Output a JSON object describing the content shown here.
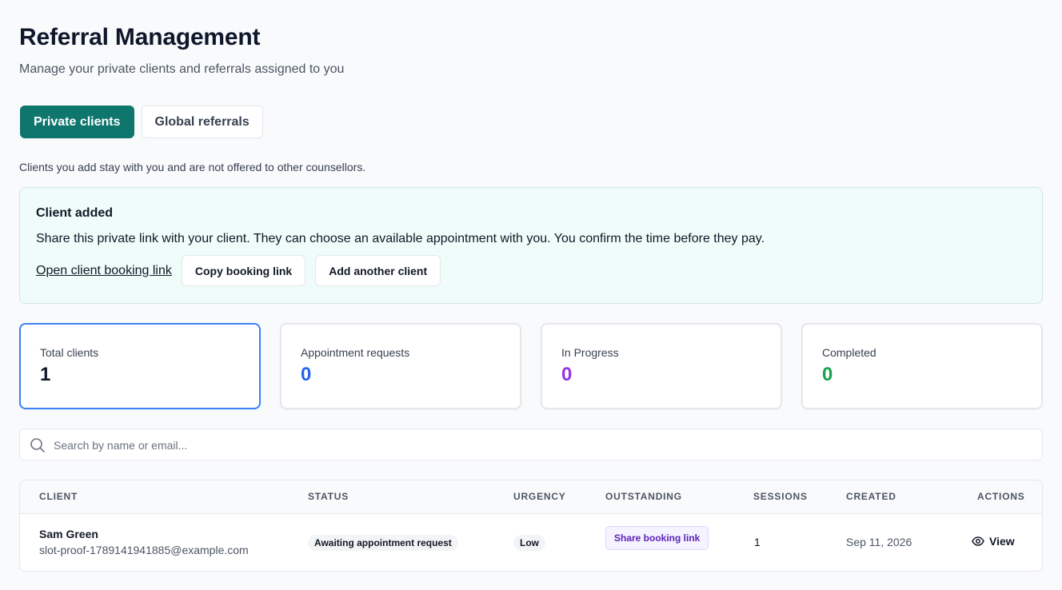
{
  "header": {
    "title": "Referral Management",
    "subtitle": "Manage your private clients and referrals assigned to you"
  },
  "tabs": [
    {
      "label": "Private clients",
      "active": true
    },
    {
      "label": "Global referrals",
      "active": false
    }
  ],
  "helper_text": "Clients you add stay with you and are not offered to other counsellors.",
  "notice": {
    "title": "Client added",
    "text": "Share this private link with your client. They can choose an available appointment with you. You confirm the time before they pay.",
    "open_link_label": "Open client booking link",
    "copy_label": "Copy booking link",
    "add_label": "Add another client"
  },
  "stats": [
    {
      "label": "Total clients",
      "value": "1",
      "color": "#111827",
      "selected": true
    },
    {
      "label": "Appointment requests",
      "value": "0",
      "color": "#2563eb",
      "selected": false
    },
    {
      "label": "In Progress",
      "value": "0",
      "color": "#9333ea",
      "selected": false
    },
    {
      "label": "Completed",
      "value": "0",
      "color": "#16a34a",
      "selected": false
    }
  ],
  "search": {
    "placeholder": "Search by name or email..."
  },
  "table": {
    "headers": {
      "client": "CLIENT",
      "status": "STATUS",
      "urgency": "URGENCY",
      "outstanding": "OUTSTANDING",
      "sessions": "SESSIONS",
      "created": "CREATED",
      "actions": "ACTIONS"
    },
    "rows": [
      {
        "name": "Sam Green",
        "email": "slot-proof-1789141941885@example.com",
        "status": "Awaiting appointment request",
        "urgency": "Low",
        "outstanding": "Share booking link",
        "sessions": "1",
        "created": "Sep 11, 2026",
        "action": "View"
      }
    ]
  },
  "icons": {
    "search": "search-icon",
    "view": "eye-icon"
  }
}
